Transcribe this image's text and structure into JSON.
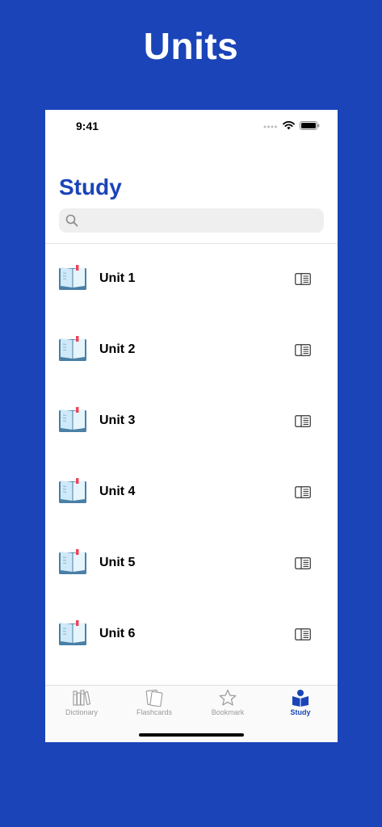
{
  "hero": {
    "title": "Units"
  },
  "status_bar": {
    "time": "9:41"
  },
  "nav": {
    "title": "Study"
  },
  "search": {
    "placeholder": "",
    "value": ""
  },
  "units": [
    {
      "label": "Unit 1"
    },
    {
      "label": "Unit 2"
    },
    {
      "label": "Unit 3"
    },
    {
      "label": "Unit 4"
    },
    {
      "label": "Unit 5"
    },
    {
      "label": "Unit 6"
    }
  ],
  "tabs": [
    {
      "label": "Dictionary",
      "icon": "books-icon",
      "active": false
    },
    {
      "label": "Flashcards",
      "icon": "cards-icon",
      "active": false
    },
    {
      "label": "Bookmark",
      "icon": "star-icon",
      "active": false
    },
    {
      "label": "Study",
      "icon": "study-reader-icon",
      "active": true
    }
  ],
  "colors": {
    "background": "#1a44b8",
    "accent": "#1a44b8",
    "inactive_tab": "#9a9a9a"
  }
}
